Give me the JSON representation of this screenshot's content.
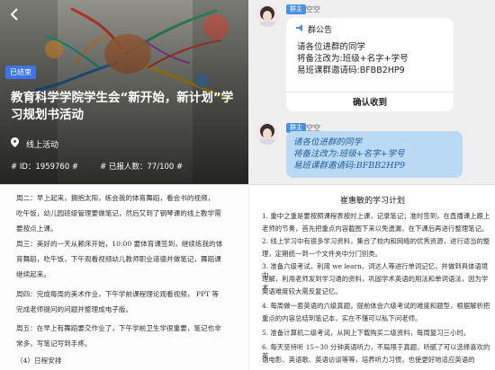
{
  "event": {
    "status_badge": "已结束",
    "title": "教育科学学院学生会“新开始，新计划”学习规划书活动",
    "location": "线上活动",
    "id_text": "# ID：1959760 #",
    "enrolled_text": "# 已报人数：77/100 #"
  },
  "chat": {
    "messages": [
      {
        "role": "群主",
        "name": "空空"
      },
      {
        "role": "群主",
        "name": "空空"
      }
    ],
    "notice": {
      "header": "群公告",
      "lines": [
        "请各位进群的同学",
        "将备注改为:班级+名字+学号",
        "易班课群邀请码:BFBB2HP9"
      ],
      "confirm": "确认收到"
    },
    "handwritten": [
      "请各位进群的同学",
      "将备注改为:班级+名字+学号",
      "易班课群邀请码:BFBB2HP9"
    ]
  },
  "doc": {
    "lines": [
      "周二：早上起来，拥抱太阳，练会我的体育舞蹈，看会书的视频，",
      "吃午饭，幼儿园班级管理要做笔记，然后又到了钢琴课的线上教学需",
      "要按点上课。",
      "周三：美好的一天从赖床开始，10:00 要体育课签到，继续练我的体",
      "育舞蹈，吃午饭，下午观看视频幼儿教师职业道德并做笔记，舞蹈课",
      "继续起来。",
      "周四：完成每周的美术作业，下午学前课程理论观看视频，   PPT 等",
      "完成老师提问的问题并整理成电子版。",
      "周五：在早上有舞蹈要交作业了，下午学前卫生学很重要，笔记也非",
      "常多，写笔记写到手疼。",
      "（4）日程安排"
    ]
  },
  "plan": {
    "title": "崔惠敏的学习计划",
    "lines": [
      "1. 重中之重是要按照课程表按时上课，记录笔记；准时签到，在直播课上跟上",
      "老师的节奏，首先把重点内容截图下来以免遗漏，在下课后再进行整理笔记。",
      "2. 线上学习中有很多学习资料，集合了校内和网络的优秀资源，进行适当的整",
      "理，定期统一到一个文件夹中分门别类。",
      "3. 准备六级考试，利用 we learn、词达人等进行单词记忆，并做到具体语境中",
      "理解，利用老师发到学习通的资料，巩固学术英语的用法和单词语法，因为学术",
      "英语难度较大需反复记忆。",
      "4. 每周做一套英语的六级真题，提前体会六级考试的难度和题型，根据解析把",
      "重点的内容总结到笔记本，实在不懂可以私下问老师。",
      "5. 准备计算机二级考试，从网上下载购买二级资料，每周复习三小时。",
      "6. 每天坚持听 15~30 分钟英语听力，不局限于真题，听腻了可以选择喜欢的英",
      "语电影、英语歌、英语访谈等等，培养听力习惯，也使更好地适应英语的"
    ]
  }
}
